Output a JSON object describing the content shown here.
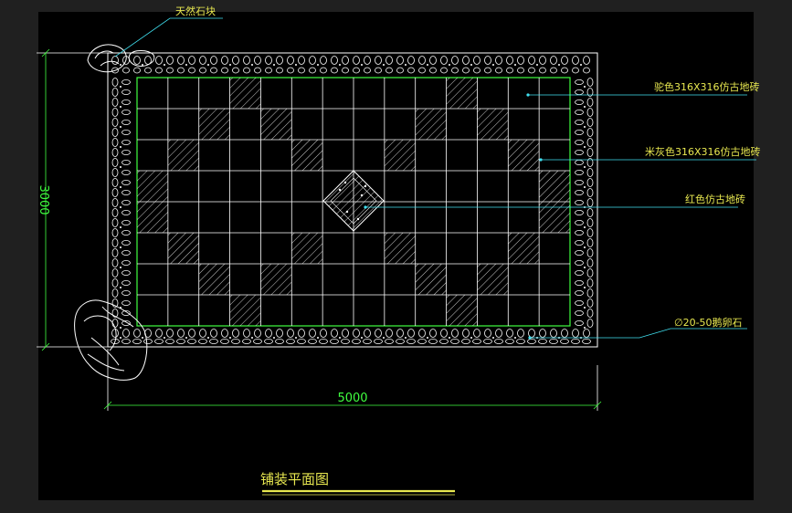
{
  "drawing": {
    "title": "铺装平面图",
    "dimension_horizontal": "5000",
    "dimension_vertical": "3000",
    "grid": {
      "columns": 14,
      "rows": 8
    },
    "hatched_cells": [
      [
        3,
        0
      ],
      [
        10,
        0
      ],
      [
        2,
        1
      ],
      [
        4,
        1
      ],
      [
        9,
        1
      ],
      [
        11,
        1
      ],
      [
        1,
        2
      ],
      [
        5,
        2
      ],
      [
        8,
        2
      ],
      [
        12,
        2
      ],
      [
        0,
        3
      ],
      [
        13,
        3
      ],
      [
        0,
        4
      ],
      [
        13,
        4
      ],
      [
        1,
        5
      ],
      [
        5,
        5
      ],
      [
        8,
        5
      ],
      [
        12,
        5
      ],
      [
        2,
        6
      ],
      [
        4,
        6
      ],
      [
        9,
        6
      ],
      [
        11,
        6
      ],
      [
        3,
        7
      ],
      [
        10,
        7
      ]
    ]
  },
  "annotations": {
    "natural_stone": "天然石块",
    "tile_camel": "驼色316X316仿古地砖",
    "tile_beige_grey": "米灰色316X316仿古地砖",
    "tile_red": "红色仿古地砖",
    "pebble": "∅20-50鹅卵石"
  },
  "colors": {
    "background": "#000000",
    "window": "#202020",
    "grid_line": "#ffffff",
    "border_green": "#40ff40",
    "leader_cyan": "#40e0f0",
    "text_yellow": "#e8e850",
    "title_underline": "#e8e850"
  }
}
